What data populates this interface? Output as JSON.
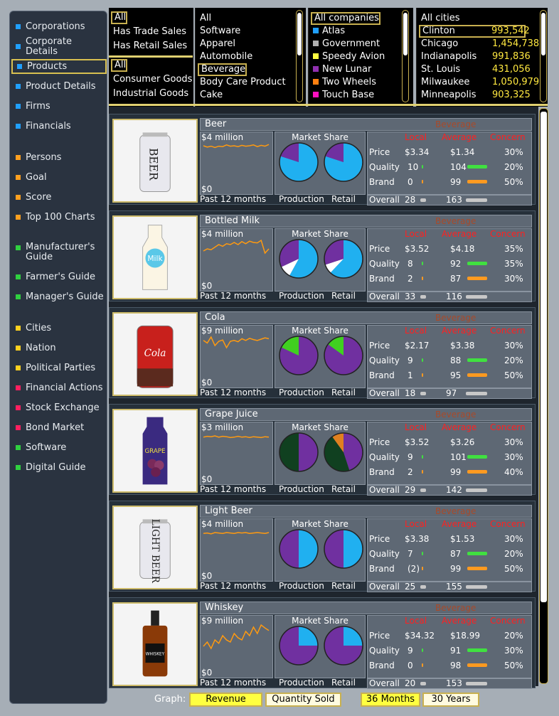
{
  "sidebar": [
    {
      "label": "Corporations",
      "color": "#20a0ff"
    },
    {
      "label": "Corporate Details",
      "color": "#20a0ff"
    },
    {
      "label": "Products",
      "color": "#20a0ff",
      "selected": true
    },
    {
      "label": "Product Details",
      "color": "#20a0ff"
    },
    {
      "label": "Firms",
      "color": "#20a0ff"
    },
    {
      "label": "Financials",
      "color": "#20a0ff"
    },
    {
      "label": "Persons",
      "color": "#ffa020"
    },
    {
      "label": "Goal",
      "color": "#ffa020"
    },
    {
      "label": "Score",
      "color": "#ffa020"
    },
    {
      "label": "Top 100 Charts",
      "color": "#ffa020"
    },
    {
      "label": "Manufacturer's Guide",
      "color": "#30d040"
    },
    {
      "label": "Farmer's Guide",
      "color": "#30d040"
    },
    {
      "label": "Manager's Guide",
      "color": "#30d040"
    },
    {
      "label": "Cities",
      "color": "#ffd020"
    },
    {
      "label": "Nation",
      "color": "#ffd020"
    },
    {
      "label": "Political Parties",
      "color": "#ffd020"
    },
    {
      "label": "Financial Actions",
      "color": "#ff2060"
    },
    {
      "label": "Stock Exchange",
      "color": "#ff2060"
    },
    {
      "label": "Bond Market",
      "color": "#ff2060"
    },
    {
      "label": "Software",
      "color": "#30d040"
    },
    {
      "label": "Digital Guide",
      "color": "#30d040"
    }
  ],
  "filter_sales": [
    "All",
    "Has Trade Sales",
    "Has Retail Sales"
  ],
  "filter_goods": [
    "All",
    "Consumer Goods",
    "Industrial Goods"
  ],
  "filter_industry": [
    "All",
    "Software",
    "Apparel",
    "Automobile",
    "Beverage",
    "Body Care Product",
    "Cake"
  ],
  "filter_companies": [
    {
      "label": "All companies",
      "color": ""
    },
    {
      "label": "Atlas",
      "color": "#20a0ff"
    },
    {
      "label": "Government",
      "color": "#b0b0b0"
    },
    {
      "label": "Speedy Avion",
      "color": "#ffff40"
    },
    {
      "label": "New Lunar",
      "color": "#9030b0"
    },
    {
      "label": "Two Wheels",
      "color": "#ff8010"
    },
    {
      "label": "Touch Base",
      "color": "#ff10c0"
    }
  ],
  "filter_cities": [
    {
      "name": "All cities",
      "pop": ""
    },
    {
      "name": "Clinton",
      "pop": "993,542"
    },
    {
      "name": "Chicago",
      "pop": "1,454,738"
    },
    {
      "name": "Indianapolis",
      "pop": "991,836"
    },
    {
      "name": "St. Louis",
      "pop": "431,056"
    },
    {
      "name": "Milwaukee",
      "pop": "1,050,979"
    },
    {
      "name": "Minneapolis",
      "pop": "903,325"
    }
  ],
  "labels": {
    "market_share": "Market Share",
    "local": "Local",
    "average": "Average",
    "concern": "Concern",
    "price": "Price",
    "quality": "Quality",
    "brand": "Brand",
    "overall": "Overall",
    "past": "Past 12 months",
    "production": "Production",
    "retail": "Retail",
    "zero": "$0"
  },
  "products": [
    {
      "name": "Beer",
      "category": "Beverage",
      "revenue": "$4 million",
      "price_local": "$3.34",
      "price_avg": "$1.34",
      "price_concern": "30%",
      "quality_local": "10",
      "quality_avg": "104",
      "quality_concern": "20%",
      "brand_local": "0",
      "brand_avg": "99",
      "brand_concern": "50%",
      "overall_local": "28",
      "overall_avg": "163",
      "prod_share": [
        [
          "#20b0f0",
          0.8
        ],
        [
          "#7030a0",
          0.2
        ]
      ],
      "retail_share": [
        [
          "#20b0f0",
          0.8
        ],
        [
          "#7030a0",
          0.2
        ]
      ],
      "trend": [
        0.75,
        0.72,
        0.74,
        0.71,
        0.74,
        0.73,
        0.77,
        0.74,
        0.75,
        0.73,
        0.76,
        0.74,
        0.75,
        0.77,
        0.73,
        0.76,
        0.74,
        0.78
      ]
    },
    {
      "name": "Bottled Milk",
      "category": "Beverage",
      "revenue": "$4 million",
      "price_local": "$3.52",
      "price_avg": "$4.18",
      "price_concern": "35%",
      "quality_local": "8",
      "quality_avg": "92",
      "quality_concern": "35%",
      "brand_local": "2",
      "brand_avg": "87",
      "brand_concern": "30%",
      "overall_local": "33",
      "overall_avg": "116",
      "prod_share": [
        [
          "#20b0f0",
          0.58
        ],
        [
          "#ffffff",
          0.1
        ],
        [
          "#7030a0",
          0.32
        ]
      ],
      "retail_share": [
        [
          "#20b0f0",
          0.62
        ],
        [
          "#ffffff",
          0.08
        ],
        [
          "#7030a0",
          0.3
        ]
      ],
      "trend": [
        0.55,
        0.6,
        0.58,
        0.64,
        0.7,
        0.66,
        0.72,
        0.7,
        0.75,
        0.7,
        0.77,
        0.72,
        0.78,
        0.75,
        0.74,
        0.8,
        0.5,
        0.6
      ]
    },
    {
      "name": "Cola",
      "category": "Beverage",
      "revenue": "$9 million",
      "price_local": "$2.17",
      "price_avg": "$3.38",
      "price_concern": "30%",
      "quality_local": "9",
      "quality_avg": "88",
      "quality_concern": "20%",
      "brand_local": "1",
      "brand_avg": "95",
      "brand_concern": "50%",
      "overall_local": "18",
      "overall_avg": "97",
      "prod_share": [
        [
          "#7030a0",
          0.82
        ],
        [
          "#40d020",
          0.18
        ]
      ],
      "retail_share": [
        [
          "#7030a0",
          0.85
        ],
        [
          "#40d020",
          0.15
        ]
      ],
      "trend": [
        0.72,
        0.66,
        0.8,
        0.6,
        0.7,
        0.73,
        0.55,
        0.7,
        0.72,
        0.69,
        0.76,
        0.72,
        0.77,
        0.74,
        0.72,
        0.75,
        0.78,
        0.76
      ]
    },
    {
      "name": "Grape Juice",
      "category": "Beverage",
      "revenue": "$3 million",
      "price_local": "$3.52",
      "price_avg": "$3.26",
      "price_concern": "30%",
      "quality_local": "9",
      "quality_avg": "101",
      "quality_concern": "30%",
      "brand_local": "2",
      "brand_avg": "99",
      "brand_concern": "40%",
      "overall_local": "29",
      "overall_avg": "142",
      "prod_share": [
        [
          "#7030a0",
          0.5
        ],
        [
          "#104020",
          0.5
        ]
      ],
      "retail_share": [
        [
          "#7030a0",
          0.45
        ],
        [
          "#104020",
          0.45
        ],
        [
          "#e08020",
          0.1
        ]
      ],
      "trend": [
        0.72,
        0.74,
        0.73,
        0.75,
        0.72,
        0.74,
        0.73,
        0.71,
        0.72,
        0.74,
        0.72,
        0.73,
        0.71,
        0.73,
        0.72,
        0.71,
        0.73,
        0.72
      ]
    },
    {
      "name": "Light Beer",
      "category": "Beverage",
      "revenue": "$4 million",
      "price_local": "$3.38",
      "price_avg": "$1.53",
      "price_concern": "30%",
      "quality_local": "7",
      "quality_avg": "87",
      "quality_concern": "20%",
      "brand_local": "(2)",
      "brand_avg": "99",
      "brand_concern": "50%",
      "overall_local": "25",
      "overall_avg": "155",
      "prod_share": [
        [
          "#20b0f0",
          0.5
        ],
        [
          "#7030a0",
          0.5
        ]
      ],
      "retail_share": [
        [
          "#20b0f0",
          0.5
        ],
        [
          "#7030a0",
          0.5
        ]
      ],
      "trend": [
        0.73,
        0.74,
        0.72,
        0.75,
        0.74,
        0.73,
        0.75,
        0.74,
        0.73,
        0.75,
        0.74,
        0.75,
        0.73,
        0.74,
        0.75,
        0.74,
        0.73,
        0.75
      ]
    },
    {
      "name": "Whiskey",
      "category": "Beverage",
      "revenue": "$9 million",
      "price_local": "$34.32",
      "price_avg": "$18.99",
      "price_concern": "20%",
      "quality_local": "9",
      "quality_avg": "91",
      "quality_concern": "30%",
      "brand_local": "0",
      "brand_avg": "98",
      "brand_concern": "50%",
      "overall_local": "20",
      "overall_avg": "153",
      "prod_share": [
        [
          "#20b0f0",
          0.25
        ],
        [
          "#7030a0",
          0.75
        ]
      ],
      "retail_share": [
        [
          "#20b0f0",
          0.25
        ],
        [
          "#7030a0",
          0.75
        ]
      ],
      "trend": [
        0.35,
        0.45,
        0.3,
        0.5,
        0.42,
        0.6,
        0.5,
        0.45,
        0.65,
        0.55,
        0.5,
        0.7,
        0.6,
        0.8,
        0.65,
        0.85,
        0.78,
        0.72
      ]
    }
  ],
  "bottom": {
    "graph_label": "Graph:",
    "revenue": "Revenue",
    "quantity": "Quantity Sold",
    "m36": "36 Months",
    "y30": "30 Years"
  }
}
